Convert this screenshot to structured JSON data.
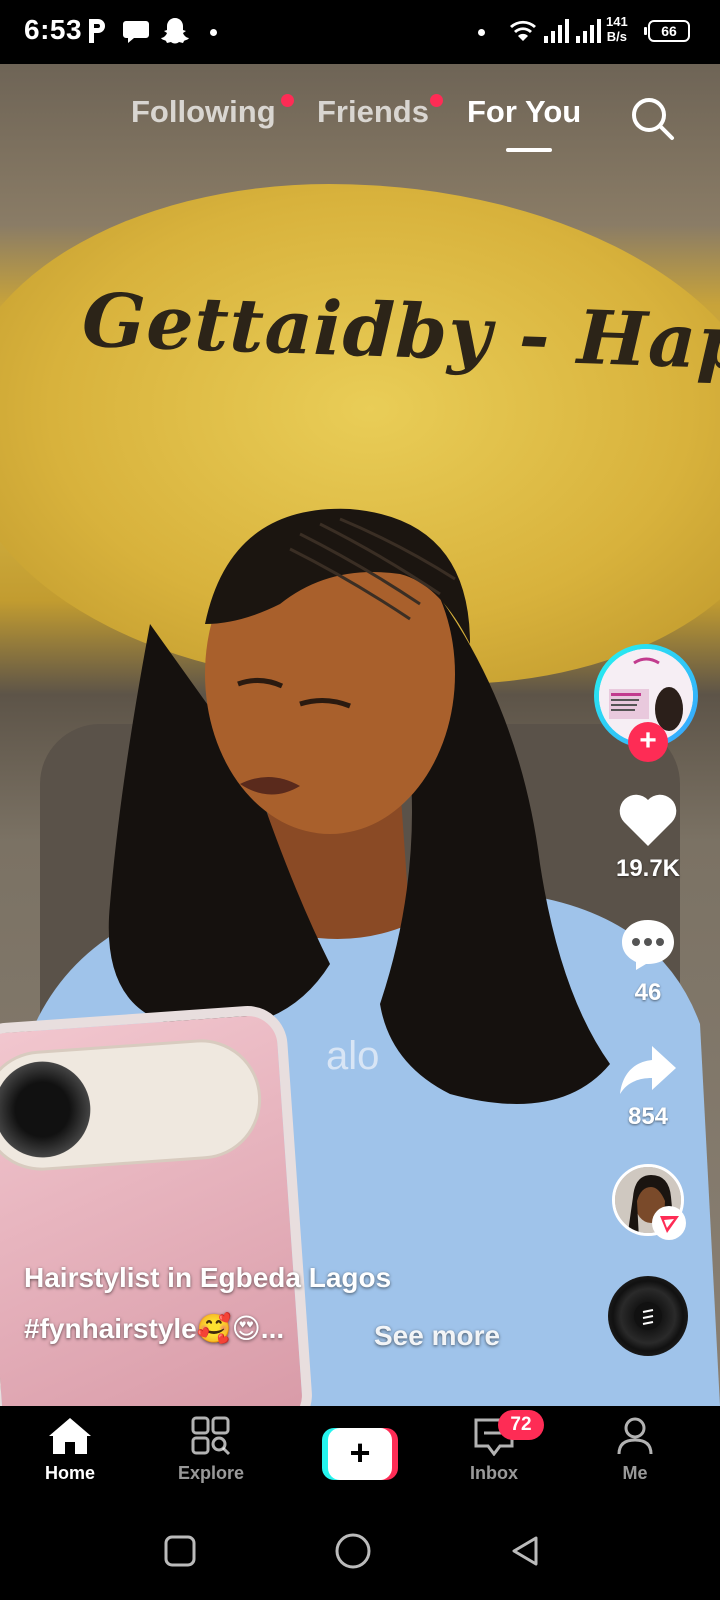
{
  "status_bar": {
    "time": "6:53",
    "net_speed_value": "141",
    "net_speed_unit": "B/s",
    "battery": "66"
  },
  "top_tabs": {
    "following": "Following",
    "friends": "Friends",
    "for_you": "For You",
    "active": "For You"
  },
  "video": {
    "wall_sign_text": "Gettaidby - Happiness"
  },
  "right_rail": {
    "likes": "19.7K",
    "comments": "46",
    "shares": "854"
  },
  "caption": {
    "title": "Hairstylist in Egbeda Lagos",
    "tags": "#fynhairstyle🥰😍...",
    "see_more": "See more"
  },
  "bottom_nav": {
    "home": "Home",
    "explore": "Explore",
    "inbox": "Inbox",
    "inbox_badge": "72",
    "me": "Me",
    "active": "Home"
  },
  "colors": {
    "accent_red": "#fe2c55",
    "accent_cyan": "#25f4ee"
  }
}
